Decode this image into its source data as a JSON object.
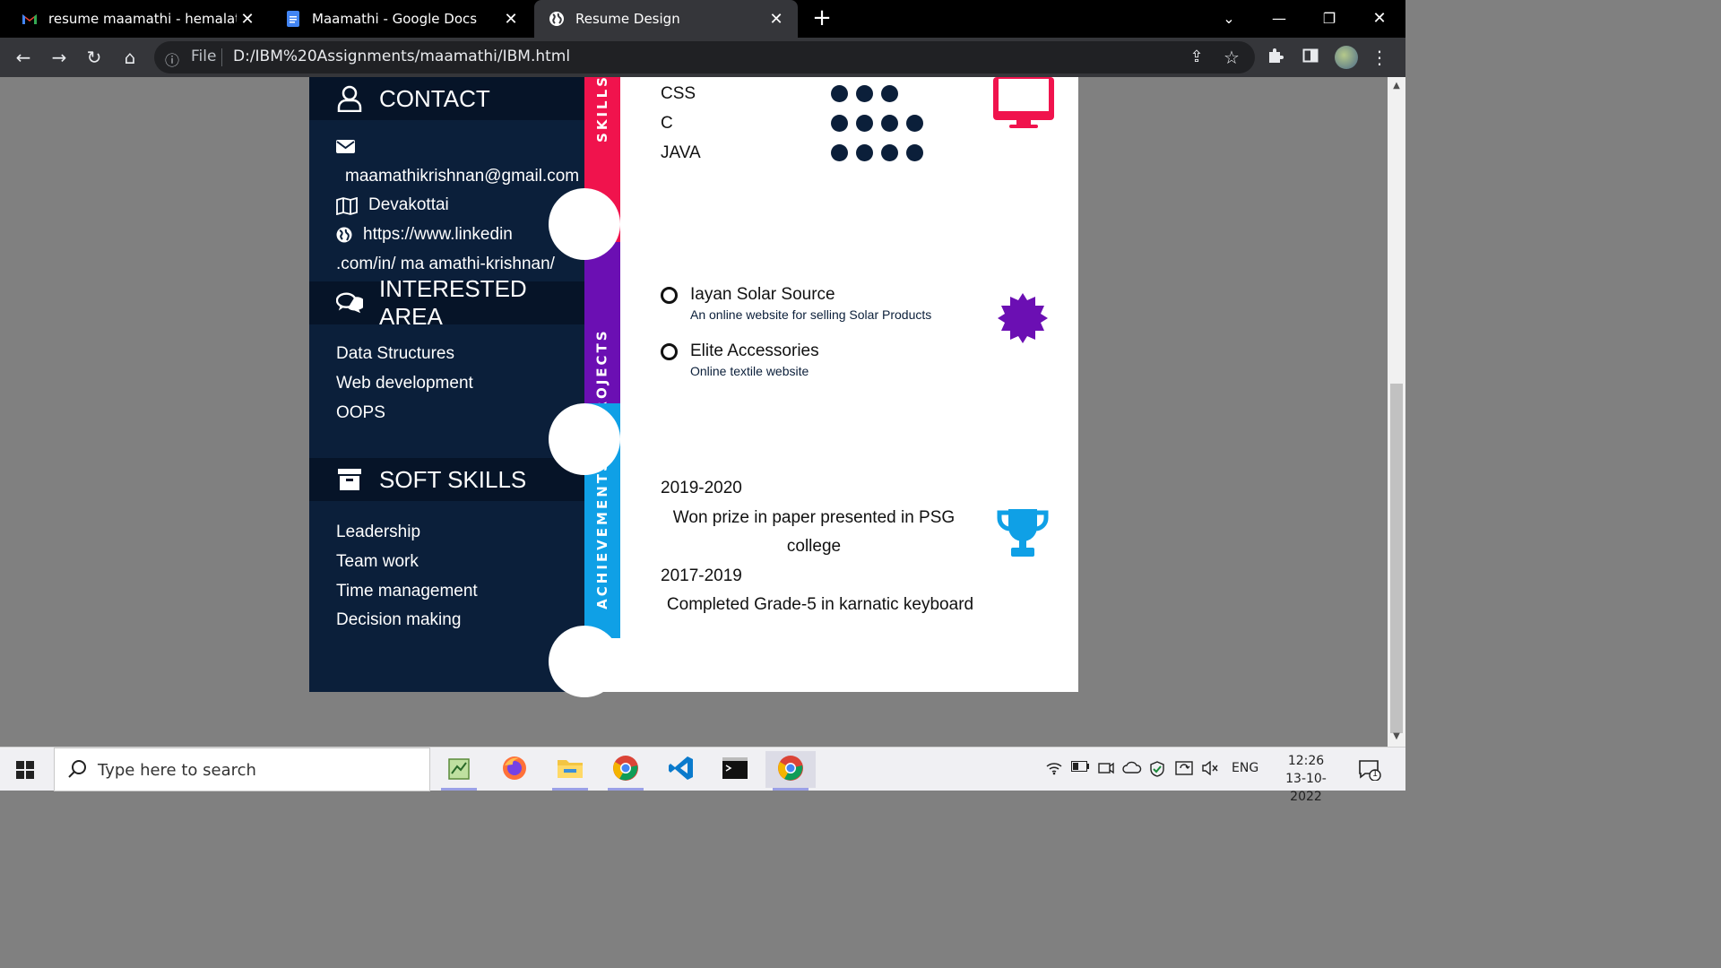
{
  "browser": {
    "tabs": [
      {
        "label": "resume maamathi - hemalathap...",
        "icon": "gmail-icon"
      },
      {
        "label": "Maamathi - Google Docs",
        "icon": "google-docs-icon"
      },
      {
        "label": "Resume Design",
        "icon": "globe-icon"
      }
    ],
    "omnibox": {
      "scheme_label": "File",
      "url": "D:/IBM%20Assignments/maamathi/IBM.html"
    }
  },
  "resume": {
    "contact": {
      "title": "CONTACT",
      "email": "maamathikrishnan@gmail.com",
      "location": "Devakottai",
      "linkedin_line1": "https://www.linkedin",
      "linkedin_line2": ".com/in/ ma amathi-krishnan/"
    },
    "interested_area": {
      "title": "INTERESTED AREA",
      "items": [
        "Data Structures",
        "Web development",
        "OOPS"
      ]
    },
    "soft_skills": {
      "title": "SOFT SKILLS",
      "items": [
        "Leadership",
        "Team work",
        "Time management",
        "Decision making"
      ]
    },
    "skills": {
      "label": "SKILLS",
      "color": "#f0134d",
      "items": [
        {
          "name": "CSS",
          "level": 3
        },
        {
          "name": "C",
          "level": 4
        },
        {
          "name": "JAVA",
          "level": 4
        }
      ]
    },
    "projects": {
      "label": "PROJECTS",
      "color": "#6b0fb3",
      "items": [
        {
          "title": "Iayan Solar Source",
          "desc": "An online website for selling Solar Products"
        },
        {
          "title": "Elite Accessories",
          "desc": "Online textile website"
        }
      ]
    },
    "achievements": {
      "label": "ACHIEVEMENTS",
      "color": "#0fa0e6",
      "items": [
        {
          "year": "2019-2020",
          "text_line1": "Won prize in paper presented in PSG",
          "text_line2": "college"
        },
        {
          "year": "2017-2019",
          "text_line1": "Completed Grade-5 in karnatic keyboard"
        }
      ]
    },
    "colors": {
      "sidebar": "#0b1f3a",
      "sidebar_header": "#061428"
    }
  },
  "taskbar": {
    "search_placeholder": "Type here to search",
    "language": "ENG",
    "time": "12:26",
    "date": "13-10-2022",
    "notification_count": "1"
  }
}
